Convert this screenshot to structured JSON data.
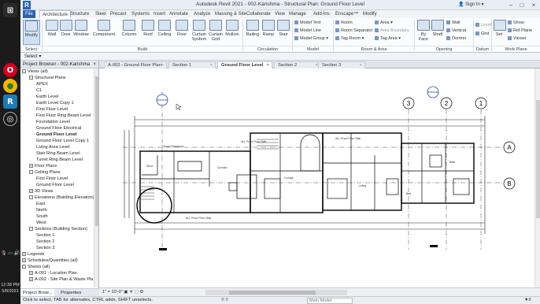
{
  "window": {
    "title": "Autodesk Revit 2021 - 002-Karishma - Structural Plan: Ground Floor Level",
    "sign_in": "Sign In",
    "logo": "R"
  },
  "taskbar": {
    "icons": [
      "start-icon",
      "opera-icon",
      "chrome-icon",
      "revit-icon",
      "app-icon"
    ],
    "time": "12:38 PM",
    "date": "5/8/2021"
  },
  "ribbon": {
    "tabs": [
      "File",
      "Architecture",
      "Structure",
      "Steel",
      "Precast",
      "Systems",
      "Insert",
      "Annotate",
      "Analyze",
      "Massing & Site",
      "Collaborate",
      "View",
      "Manage",
      "Add-Ins",
      "Enscape™",
      "Modify"
    ],
    "build_buttons": [
      "Modify",
      "Wall",
      "Door",
      "Window",
      "Component",
      "Column",
      "Roof",
      "Ceiling",
      "Floor",
      "Curtain System",
      "Curtain Grid",
      "Mullion"
    ],
    "circulation_buttons": [
      "Railing",
      "Ramp",
      "Stair"
    ],
    "model_items": [
      "Model Text",
      "Model Line",
      "Model Group"
    ],
    "room_items": [
      "Room",
      "Room Separator",
      "Tag Room"
    ],
    "area_items": [
      "Area",
      "Area Boundary",
      "Tag Area"
    ],
    "opening_items": [
      "By Face",
      "Shaft",
      "Wall",
      "Vertical",
      "Dormer"
    ],
    "datum_items": [
      "Level",
      "Grid"
    ],
    "workplane_items": [
      "Set",
      "Show",
      "Ref Plane",
      "Viewer"
    ],
    "panels": [
      "Select",
      "Build",
      "Circulation",
      "Model",
      "Room & Area",
      "Opening",
      "Datum",
      "Work Plane"
    ]
  },
  "options": {
    "select_label": "Select"
  },
  "browser": {
    "title": "Project Browser - 002-Karishma",
    "items": [
      {
        "label": "Views (all)",
        "level": 0,
        "exp": "-"
      },
      {
        "label": "Structural Plans",
        "level": 1,
        "exp": "-"
      },
      {
        "label": "APEX",
        "level": 2
      },
      {
        "label": "C1",
        "level": 2
      },
      {
        "label": "Earth Level",
        "level": 2
      },
      {
        "label": "Earth Level Copy 1",
        "level": 2
      },
      {
        "label": "First Floor Level",
        "level": 2
      },
      {
        "label": "First Floor Ring Beam Level",
        "level": 2
      },
      {
        "label": "Foundation Level",
        "level": 2
      },
      {
        "label": "Ground Floor Electrical",
        "level": 2
      },
      {
        "label": "Ground Floor Level",
        "level": 2,
        "bold": true
      },
      {
        "label": "Ground Floor Level Copy 1",
        "level": 2
      },
      {
        "label": "Living Area Level",
        "level": 2
      },
      {
        "label": "Stair Ring Beam Level",
        "level": 2
      },
      {
        "label": "Turret Ring Beam Level",
        "level": 2
      },
      {
        "label": "Floor Plans",
        "level": 1,
        "exp": "+"
      },
      {
        "label": "Ceiling Plans",
        "level": 1,
        "exp": "-"
      },
      {
        "label": "First Floor Level",
        "level": 2
      },
      {
        "label": "Ground Floor Level",
        "level": 2
      },
      {
        "label": "3D Views",
        "level": 1,
        "exp": "+"
      },
      {
        "label": "Elevations (Building Elevation)",
        "level": 1,
        "exp": "-"
      },
      {
        "label": "East",
        "level": 2
      },
      {
        "label": "North",
        "level": 2
      },
      {
        "label": "South",
        "level": 2
      },
      {
        "label": "West",
        "level": 2
      },
      {
        "label": "Sections (Building Section)",
        "level": 1,
        "exp": "-"
      },
      {
        "label": "Section 1",
        "level": 2
      },
      {
        "label": "Section 2",
        "level": 2
      },
      {
        "label": "Section 3",
        "level": 2
      },
      {
        "label": "Legends",
        "level": 0,
        "exp": "+"
      },
      {
        "label": "Schedules/Quantities (all)",
        "level": 0,
        "exp": "+"
      },
      {
        "label": "Sheets (all)",
        "level": 0,
        "exp": "-"
      },
      {
        "label": "A-001 - Location Plan",
        "level": 1,
        "exp": "+"
      },
      {
        "label": "A-002 - Site Plan & Waste Pla",
        "level": 1,
        "exp": "+"
      }
    ],
    "tabs": [
      "Project Brow...",
      "Properties"
    ]
  },
  "doc_tabs": [
    "A-003 - Ground Floor Plan",
    "Section 1",
    "Ground Floor Level",
    "Section 2",
    "Section 3"
  ],
  "drawing": {
    "grids_top": [
      "3",
      "2",
      "1"
    ],
    "grids_right": [
      "A",
      "B"
    ]
  },
  "viewbar": {
    "scale": "1\" = 10'-0\""
  },
  "status": {
    "message": "Click to select, TAB for alternates, CTRL adds, SHIFT unselects.",
    "workset": "0",
    "model": "Main Model",
    "filter": "0"
  }
}
